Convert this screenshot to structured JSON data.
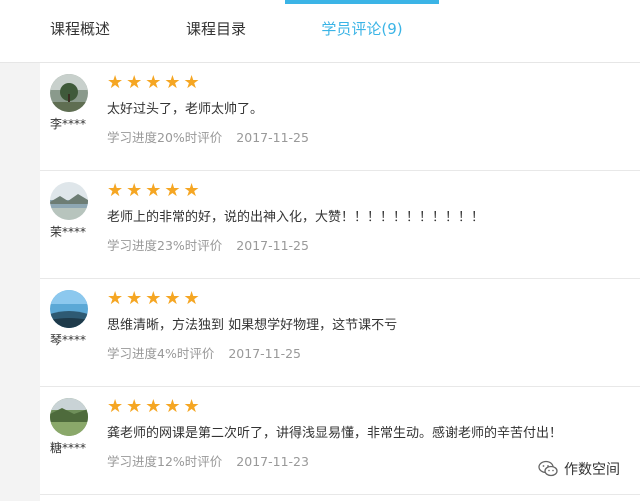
{
  "tabs": [
    {
      "label": "课程概述",
      "active": false
    },
    {
      "label": "课程目录",
      "active": false
    },
    {
      "label": "学员评论(9)",
      "active": true
    }
  ],
  "accent_color": "#3bb4e6",
  "star_color": "#f5a623",
  "reviews": [
    {
      "user": "李****",
      "stars": "★★★★★",
      "rating": 5,
      "comment": "太好过头了，老师太帅了。",
      "progress": "学习进度20%时评价",
      "date": "2017-11-25"
    },
    {
      "user": "茉****",
      "stars": "★★★★★",
      "rating": 5,
      "comment": "老师上的非常的好，说的出神入化，大赞！！！！！！！！！！！",
      "progress": "学习进度23%时评价",
      "date": "2017-11-25"
    },
    {
      "user": "琴****",
      "stars": "★★★★★",
      "rating": 5,
      "comment": "思维清晰，方法独到 如果想学好物理，这节课不亏",
      "progress": "学习进度4%时评价",
      "date": "2017-11-25"
    },
    {
      "user": "糖****",
      "stars": "★★★★★",
      "rating": 5,
      "comment": "龚老师的网课是第二次听了，讲得浅显易懂，非常生动。感谢老师的辛苦付出！",
      "progress": "学习进度12%时评价",
      "date": "2017-11-23"
    }
  ],
  "watermark": {
    "text": "作数空间",
    "icon": "wechat-logo-icon"
  }
}
